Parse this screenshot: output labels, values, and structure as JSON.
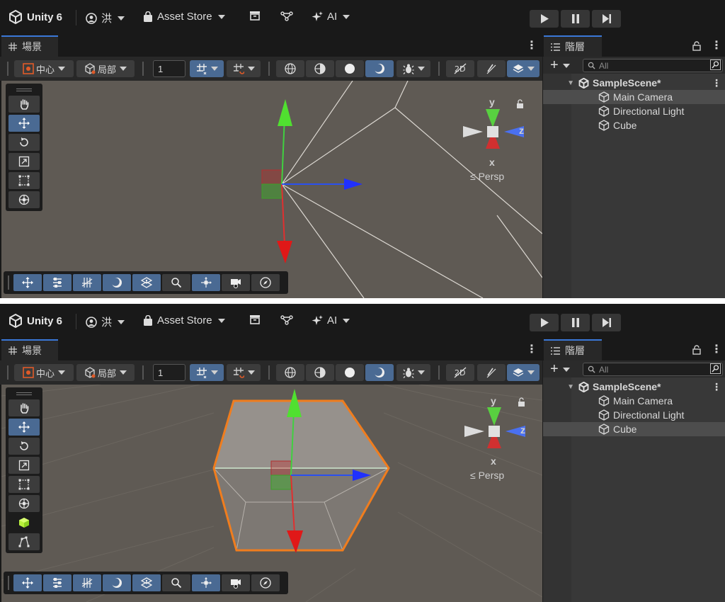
{
  "app": {
    "name": "Unity 6",
    "user": "洪",
    "asset_store": "Asset Store",
    "ai": "AI"
  },
  "tabs": {
    "scene": "場景",
    "hierarchy": "階層"
  },
  "scene_toolbar": {
    "pivot": "中心",
    "space": "局部",
    "grid_value": "1"
  },
  "hierarchy": {
    "search_placeholder": "All",
    "scene_name": "SampleScene*",
    "items": [
      "Main Camera",
      "Directional Light",
      "Cube"
    ]
  },
  "gizmo": {
    "y": "y",
    "x": "x",
    "z": "z",
    "persp": "≤ Persp"
  },
  "panels": [
    {
      "id": "before",
      "selected_item": "Main Camera",
      "cube_visible": false
    },
    {
      "id": "after",
      "selected_item": "Cube",
      "cube_visible": true
    }
  ],
  "colors": {
    "accent": "#4a6a93",
    "selection_orange": "#f07d1e",
    "axis_x": "#e02020",
    "axis_y": "#30d020",
    "axis_z": "#2050f0"
  }
}
